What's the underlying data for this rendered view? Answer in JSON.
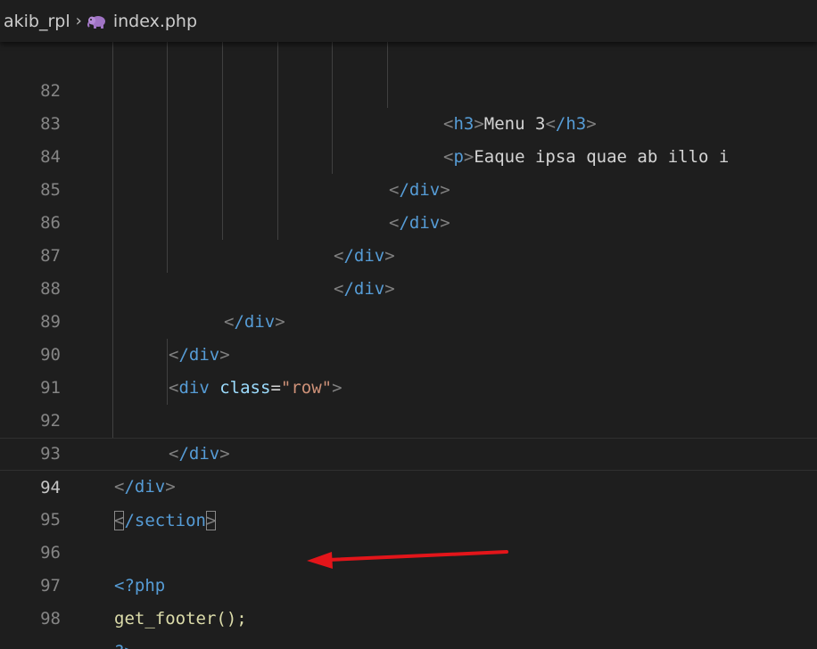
{
  "breadcrumb": {
    "folder": "akib_rpl",
    "separator": "›",
    "file": "index.php",
    "file_icon": "php-elephant-icon"
  },
  "colors": {
    "background": "#1e1e1e",
    "tag": "#569cd6",
    "attribute": "#9cdcfe",
    "string": "#ce9178",
    "bracket": "#808080",
    "function": "#dcdcaa",
    "annotation_arrow": "#e3151a"
  },
  "lines": [
    {
      "number": "82",
      "h3_open": "h3",
      "h3_text": "Menu 3",
      "h3_close": "/h3"
    },
    {
      "number": "83",
      "p_tag": "p",
      "p_text": "Eaque ipsa quae ab illo i"
    },
    {
      "number": "84",
      "close_tag": "/div"
    },
    {
      "number": "85",
      "close_tag": "/div"
    },
    {
      "number": "86",
      "close_tag": "/div"
    },
    {
      "number": "87",
      "close_tag": "/div"
    },
    {
      "number": "88",
      "close_tag": "/div"
    },
    {
      "number": "89",
      "close_tag": "/div"
    },
    {
      "number": "90",
      "tag": "div",
      "attr": "class",
      "eq": "=",
      "value": "\"row\""
    },
    {
      "number": "91"
    },
    {
      "number": "92",
      "close_tag": "/div"
    },
    {
      "number": "93",
      "close_tag": "/div"
    },
    {
      "number": "94",
      "close_tag": "/section"
    },
    {
      "number": "95"
    },
    {
      "number": "96",
      "php_open": "<?php"
    },
    {
      "number": "97",
      "call": "get_footer();"
    },
    {
      "number": "98",
      "php_close": "?>"
    }
  ],
  "active_line": "94"
}
